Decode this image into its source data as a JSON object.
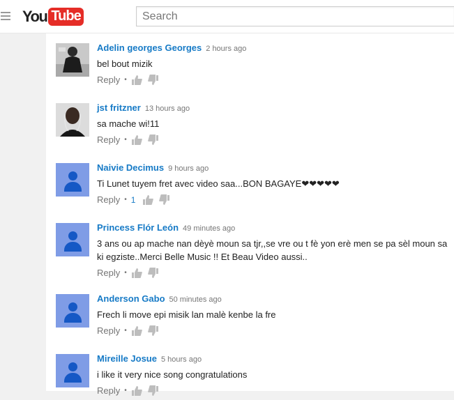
{
  "header": {
    "logo_you": "You",
    "logo_tube": "Tube",
    "search_placeholder": "Search"
  },
  "comments": [
    {
      "author": "Adelin georges Georges",
      "time": "2 hours ago",
      "text": "bel bout mizik",
      "reply": "Reply",
      "likes": "",
      "avatar": "photo-person-dark"
    },
    {
      "author": "jst fritzner",
      "time": "13 hours ago",
      "text": "sa mache wi!11",
      "reply": "Reply",
      "likes": "",
      "avatar": "photo-person-headphones"
    },
    {
      "author": "Naivie Decimus",
      "time": "9 hours ago",
      "text": "Ti Lunet tuyem fret avec video saa...BON BAGAYE❤❤❤❤❤",
      "reply": "Reply",
      "likes": "1",
      "avatar": "default-avatar"
    },
    {
      "author": "Princess Flór León",
      "time": "49 minutes ago",
      "text": "3 ans ou ap mache nan dèyè moun sa tjr,,se vre ou t fè yon erè men se pa sèl moun sa ki egziste..Merci Belle Music !! Et Beau Video aussi..",
      "reply": "Reply",
      "likes": "",
      "avatar": "default-avatar"
    },
    {
      "author": "Anderson Gabo",
      "time": "50 minutes ago",
      "text": "Frech li move epi misik lan malè kenbe la fre",
      "reply": "Reply",
      "likes": "",
      "avatar": "default-avatar"
    },
    {
      "author": "Mireille Josue",
      "time": "5 hours ago",
      "text": "i like it  very nice song congratulations",
      "reply": "Reply",
      "likes": "",
      "avatar": "default-avatar"
    }
  ],
  "colors": {
    "link_blue": "#167ac6",
    "logo_red": "#e52d27",
    "avatar_bg": "#7f9ce6",
    "avatar_fg": "#1558c5"
  },
  "icons": [
    "menu-icon",
    "thumbs-up-icon",
    "thumbs-down-icon"
  ]
}
